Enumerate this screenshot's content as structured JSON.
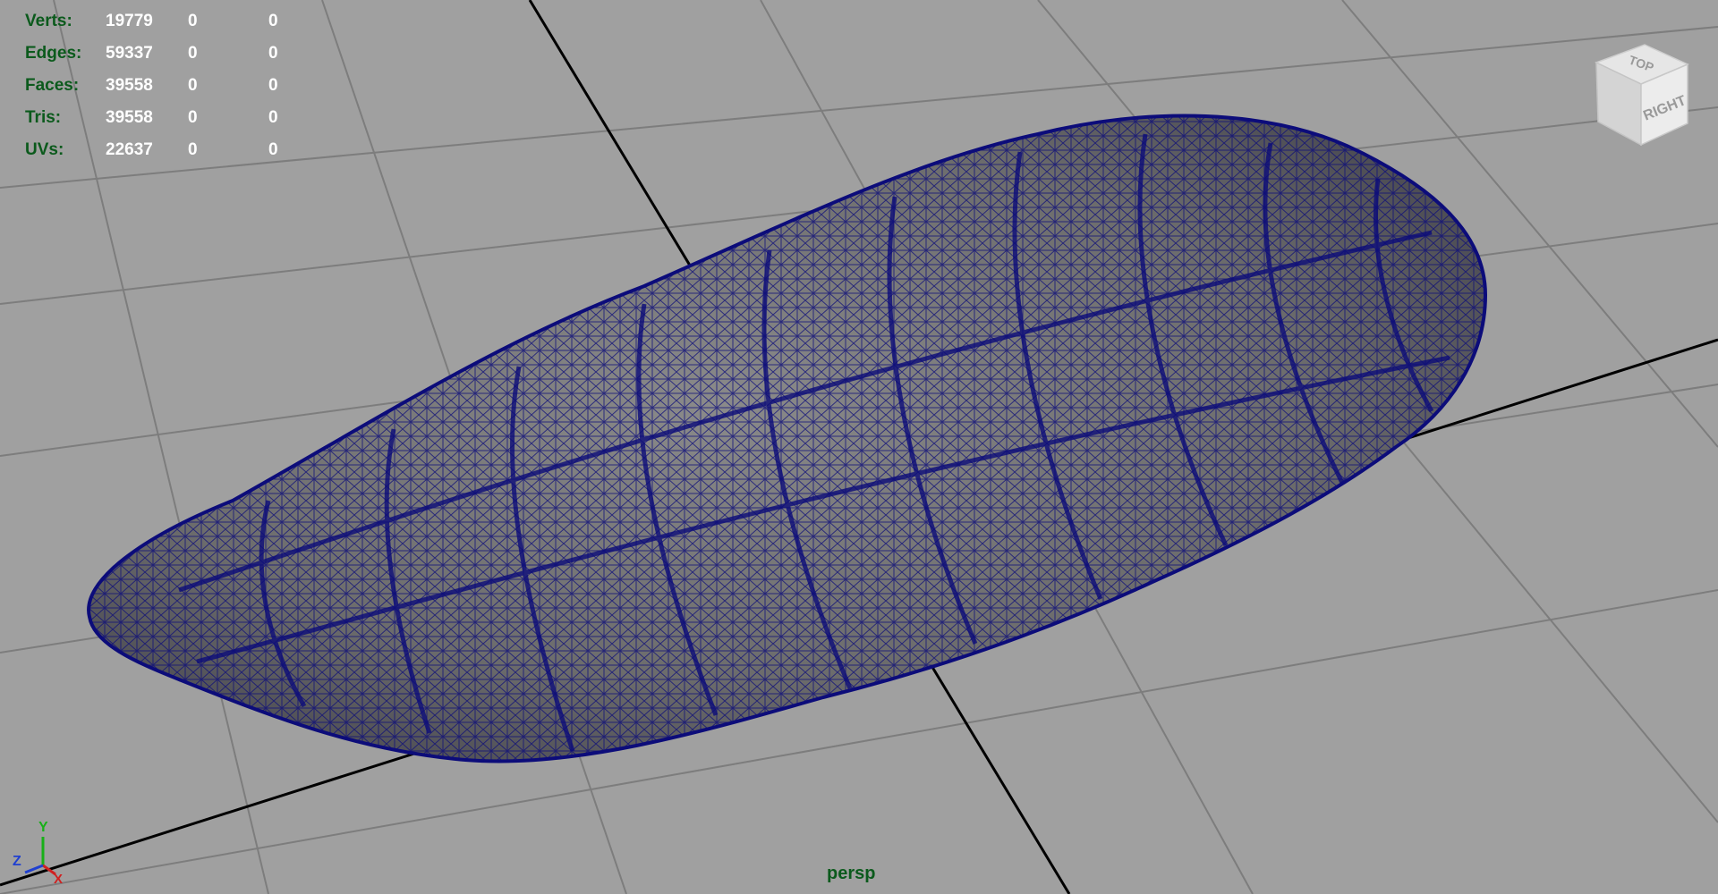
{
  "hud": {
    "rows": [
      {
        "label": "Verts:",
        "v1": "19779",
        "v2": "0",
        "v3": "0"
      },
      {
        "label": "Edges:",
        "v1": "59337",
        "v2": "0",
        "v3": "0"
      },
      {
        "label": "Faces:",
        "v1": "39558",
        "v2": "0",
        "v3": "0"
      },
      {
        "label": "Tris:",
        "v1": "39558",
        "v2": "0",
        "v3": "0"
      },
      {
        "label": "UVs:",
        "v1": "22637",
        "v2": "0",
        "v3": "0"
      }
    ]
  },
  "viewcube": {
    "top_label": "TOP",
    "right_label": "RIGHT"
  },
  "axis": {
    "y": "Y",
    "z": "Z",
    "x": "X"
  },
  "camera": {
    "name": "persp"
  },
  "colors": {
    "background": "#a0a0a0",
    "grid": "#7d7d7d",
    "axis_line": "#000000",
    "wireframe": "#0c0c7a",
    "mesh_fill": "#7f7f7f",
    "hud_label": "#0b5a1c",
    "hud_value": "#ffffff"
  }
}
